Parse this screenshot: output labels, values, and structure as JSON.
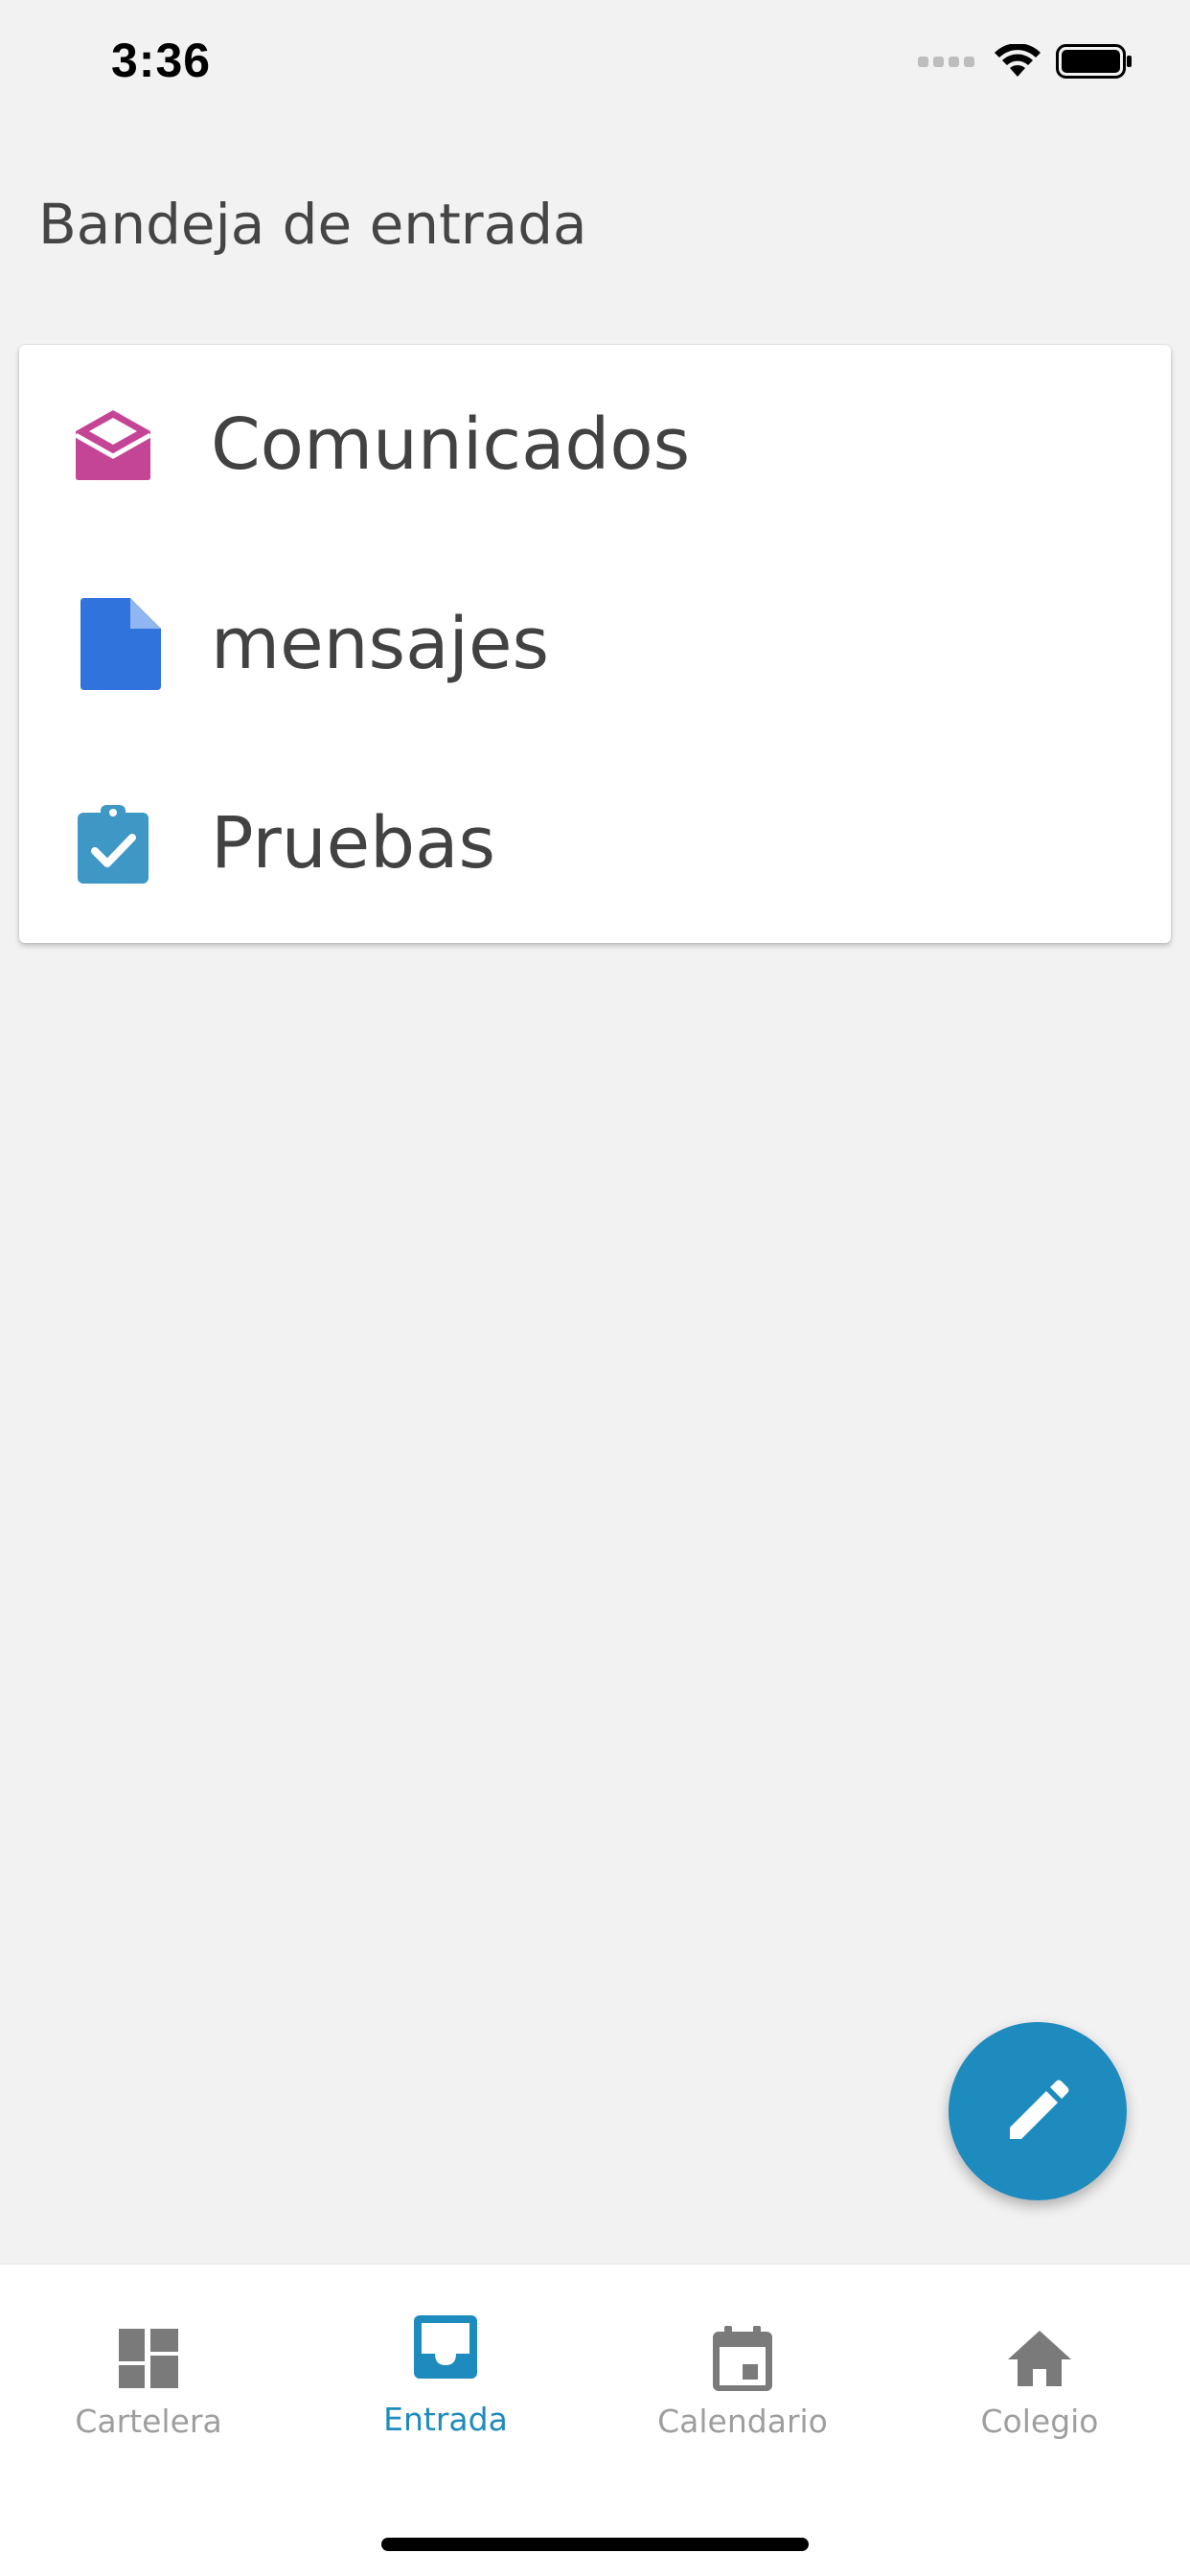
{
  "status_bar": {
    "time": "3:36"
  },
  "header": {
    "title": "Bandeja de entrada"
  },
  "inbox_list": {
    "items": [
      {
        "label": "Comunicados",
        "icon": "open-envelope-icon",
        "icon_color": "#c44595"
      },
      {
        "label": "mensajes",
        "icon": "document-icon",
        "icon_color": "#3073dc"
      },
      {
        "label": "Pruebas",
        "icon": "clipboard-check-icon",
        "icon_color": "#3f97c6"
      }
    ]
  },
  "fab": {
    "icon": "pencil-icon",
    "color": "#1e8bbf"
  },
  "bottom_nav": {
    "active_color": "#1e8bbf",
    "inactive_color": "#7a7a7a",
    "tabs": [
      {
        "label": "Cartelera",
        "icon": "dashboard-icon",
        "active": false
      },
      {
        "label": "Entrada",
        "icon": "inbox-icon",
        "active": true
      },
      {
        "label": "Calendario",
        "icon": "calendar-icon",
        "active": false
      },
      {
        "label": "Colegio",
        "icon": "home-icon",
        "active": false
      }
    ]
  }
}
